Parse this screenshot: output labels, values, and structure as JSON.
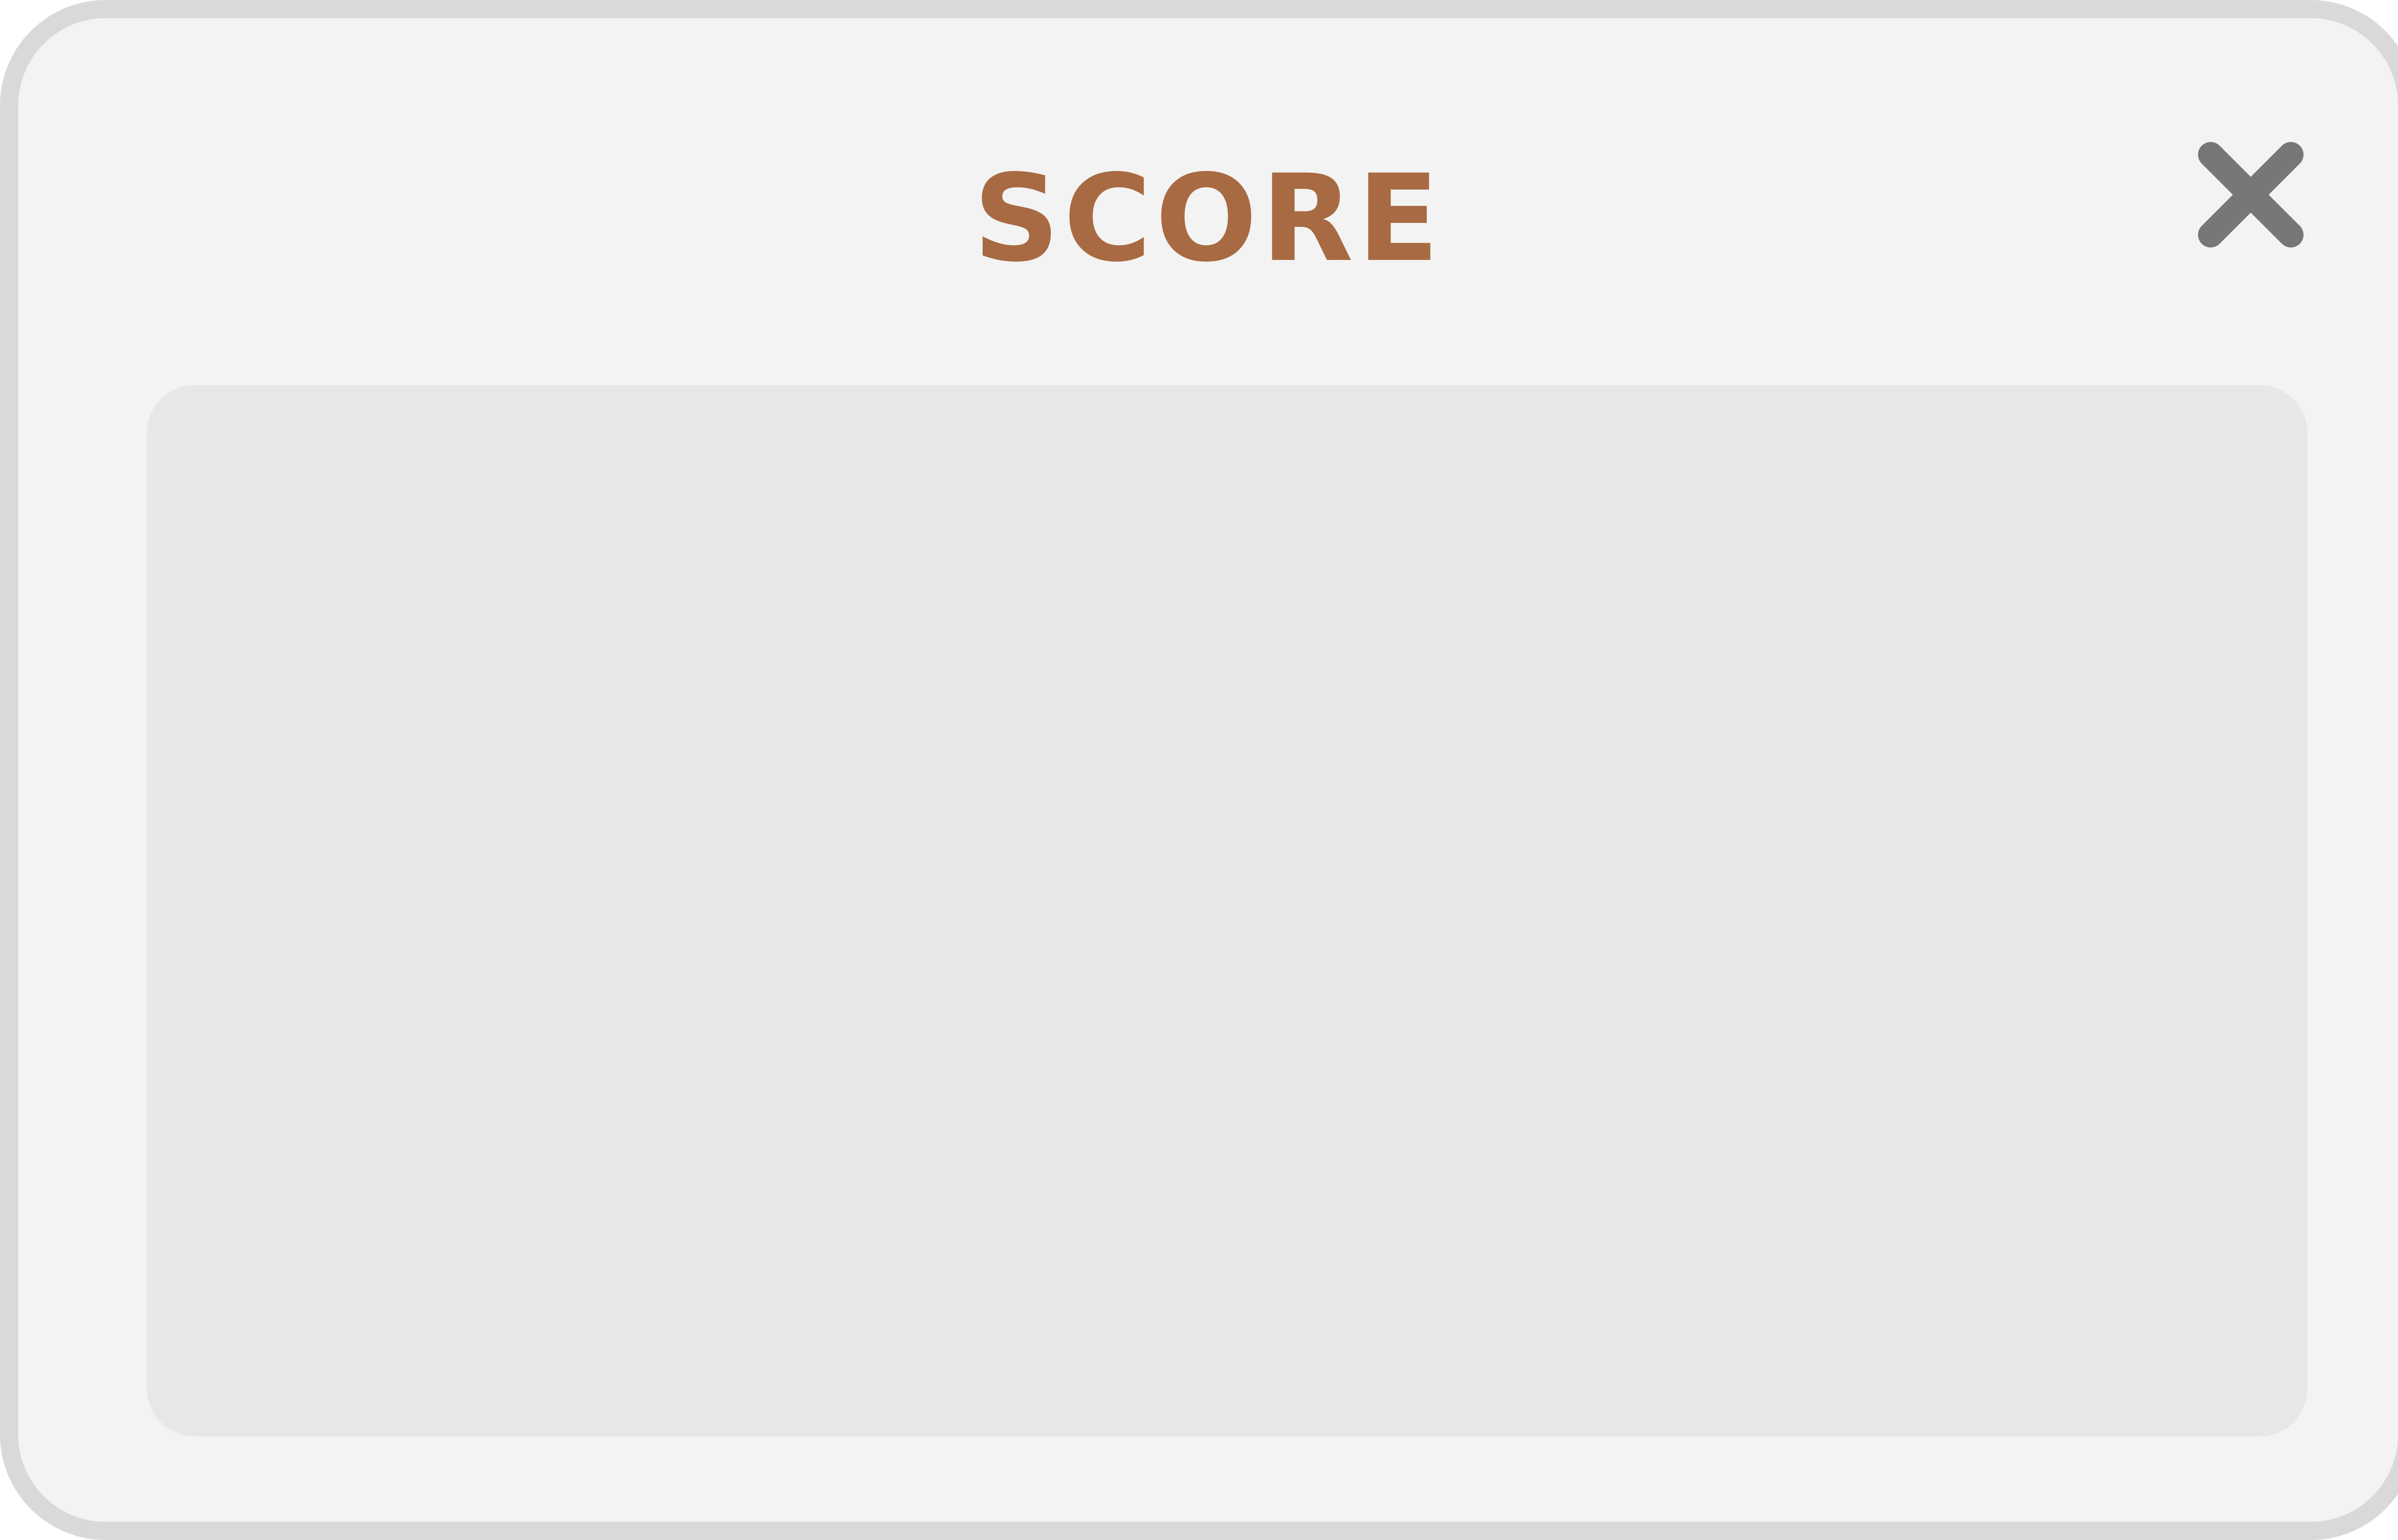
{
  "dialog": {
    "title": "SCORE",
    "close_icon": "close-icon",
    "content": {
      "items": []
    }
  },
  "colors": {
    "panel_background": "#f3f3f3",
    "panel_border": "#d9d9d9",
    "content_background": "#e7e7e7",
    "title_color": "#a86a42",
    "close_icon_color": "#777777"
  }
}
